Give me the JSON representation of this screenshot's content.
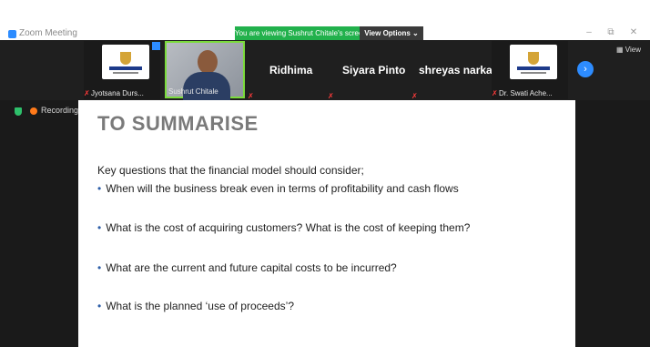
{
  "window": {
    "app_title": "Zoom Meeting",
    "viewing_banner": "You are viewing Sushrut Chitale's screen",
    "view_options_label": "View Options ⌄",
    "minimize": "–",
    "restore": "⧉",
    "close": "✕"
  },
  "participants": [
    {
      "name": "Jyotsana Durs..."
    },
    {
      "name": "Sushrut Chitale"
    },
    {
      "name": "Ridhima"
    },
    {
      "name": "Siyara Pinto"
    },
    {
      "name": "shreyas narkar"
    },
    {
      "name": "Dr. Swati Ache..."
    }
  ],
  "strip": {
    "next_label": "›",
    "view_label": "View"
  },
  "recording": {
    "label": "Recording"
  },
  "slide": {
    "title": "TO SUMMARISE",
    "intro": "Key questions that the financial model should consider;",
    "bullets": [
      "When will the business break even in terms of profitability and cash flows",
      "What is the cost of acquiring customers? What is the cost of keeping them?",
      "What are the current and future capital costs to be incurred?",
      "What is the planned ‘use of proceeds’?"
    ]
  },
  "colors": {
    "banner_green": "#22b14c",
    "accent_blue": "#2d8cff",
    "active_speaker": "#7bdc3b",
    "muted_red": "#ff3b3b"
  }
}
